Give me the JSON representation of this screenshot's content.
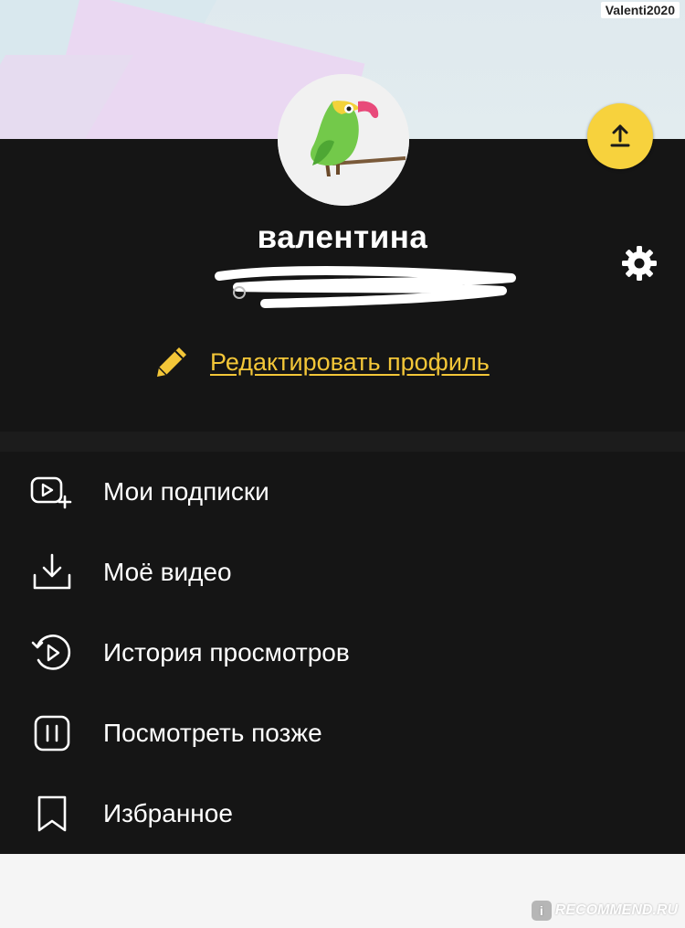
{
  "watermark": {
    "top": "Valenti2020",
    "bottom_logo": "i",
    "bottom": "RECOMMEND.RU"
  },
  "profile": {
    "name": "валентина",
    "edit_label": "Редактировать профиль"
  },
  "menu": {
    "items": [
      {
        "label": "Мои подписки",
        "icon": "subscriptions-icon"
      },
      {
        "label": "Моё видео",
        "icon": "download-icon"
      },
      {
        "label": "История просмотров",
        "icon": "history-icon"
      },
      {
        "label": "Посмотреть позже",
        "icon": "watch-later-icon"
      },
      {
        "label": "Избранное",
        "icon": "bookmark-icon"
      }
    ]
  },
  "colors": {
    "accent": "#f7d23d",
    "link": "#f3c638",
    "panel": "#151515"
  }
}
